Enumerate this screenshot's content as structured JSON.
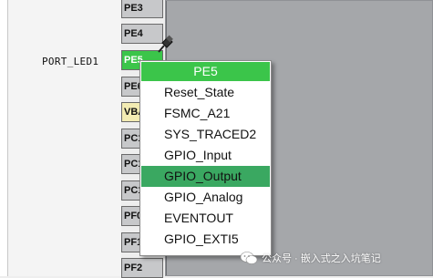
{
  "pins": [
    {
      "label": "PE3",
      "style": "grey"
    },
    {
      "label": "PE4",
      "style": "grey"
    },
    {
      "label": "PE5",
      "style": "green"
    },
    {
      "label": "PE6",
      "style": "grey"
    },
    {
      "label": "VBAT",
      "style": "yellow"
    },
    {
      "label": "PC13",
      "style": "grey"
    },
    {
      "label": "PC14",
      "style": "grey"
    },
    {
      "label": "PC15",
      "style": "grey"
    },
    {
      "label": "PF0",
      "style": "grey"
    },
    {
      "label": "PF1",
      "style": "grey"
    },
    {
      "label": "PF2",
      "style": "grey"
    }
  ],
  "port_label": "PORT_LED1",
  "menu": {
    "title": "PE5",
    "items": [
      {
        "label": "Reset_State",
        "selected": false
      },
      {
        "label": "FSMC_A21",
        "selected": false
      },
      {
        "label": "SYS_TRACED2",
        "selected": false
      },
      {
        "label": "GPIO_Input",
        "selected": false
      },
      {
        "label": "GPIO_Output",
        "selected": true
      },
      {
        "label": "GPIO_Analog",
        "selected": false
      },
      {
        "label": "EVENTOUT",
        "selected": false
      },
      {
        "label": "GPIO_EXTI5",
        "selected": false
      }
    ]
  },
  "watermark": "公众号 · 嵌入式之入坑笔记",
  "colors": {
    "pin_green": "#3bc54a",
    "selected_item": "#3aa861",
    "chip_body": "#a5a7aa",
    "vbat_yellow": "#f3ecb3"
  },
  "icons": {
    "pushpin": "pushpin-icon",
    "watermark_logo": "wechat-icon"
  }
}
